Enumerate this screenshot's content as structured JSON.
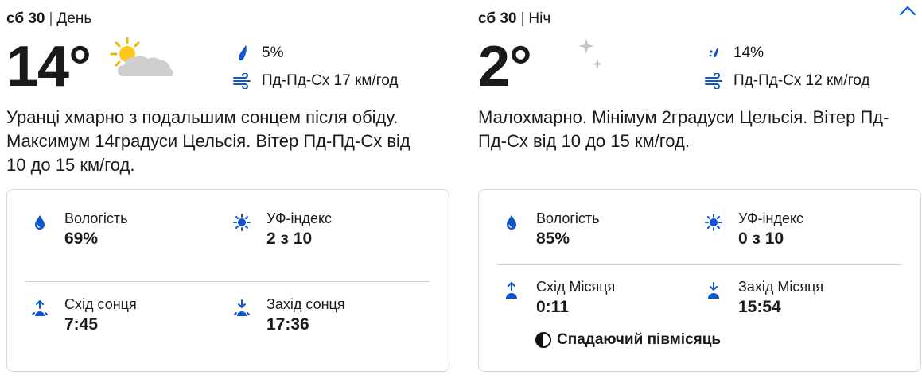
{
  "colors": {
    "accent": "#0b5ed7",
    "icon_blue": "#1155cc",
    "moon_gray": "#c8c8c8"
  },
  "day": {
    "date": "сб 30",
    "period": "День",
    "temperature": "14°",
    "condition_icon": "partly-sunny-cloud-icon",
    "precipitation": "5%",
    "wind": "Пд-Пд-Сх 17 км/год",
    "description": "Уранці хмарно з подальшим сонцем після обіду. Максимум 14градуси Цельсія. Вітер Пд-Пд-Сх від 10 до 15 км/год.",
    "details": {
      "humidity_label": "Вологість",
      "humidity_value": "69%",
      "uv_label": "УФ-індекс",
      "uv_value": "2 з 10",
      "sunrise_label": "Схід сонця",
      "sunrise_value": "7:45",
      "sunset_label": "Захід сонця",
      "sunset_value": "17:36"
    }
  },
  "night": {
    "date": "сб 30",
    "period": "Ніч",
    "temperature": "2°",
    "condition_icon": "moon-stars-icon",
    "precipitation": "14%",
    "wind": "Пд-Пд-Сх 12 км/год",
    "description": "Малохмарно. Мінімум 2градуси Цельсія. Вітер Пд-Пд-Сх від 10 до 15 км/год.",
    "details": {
      "humidity_label": "Вологість",
      "humidity_value": "85%",
      "uv_label": "УФ-індекс",
      "uv_value": "0 з 10",
      "moonrise_label": "Схід Місяця",
      "moonrise_value": "0:11",
      "moonset_label": "Захід Місяця",
      "moonset_value": "15:54",
      "moon_phase": "Спадаючий півмісяць"
    }
  }
}
